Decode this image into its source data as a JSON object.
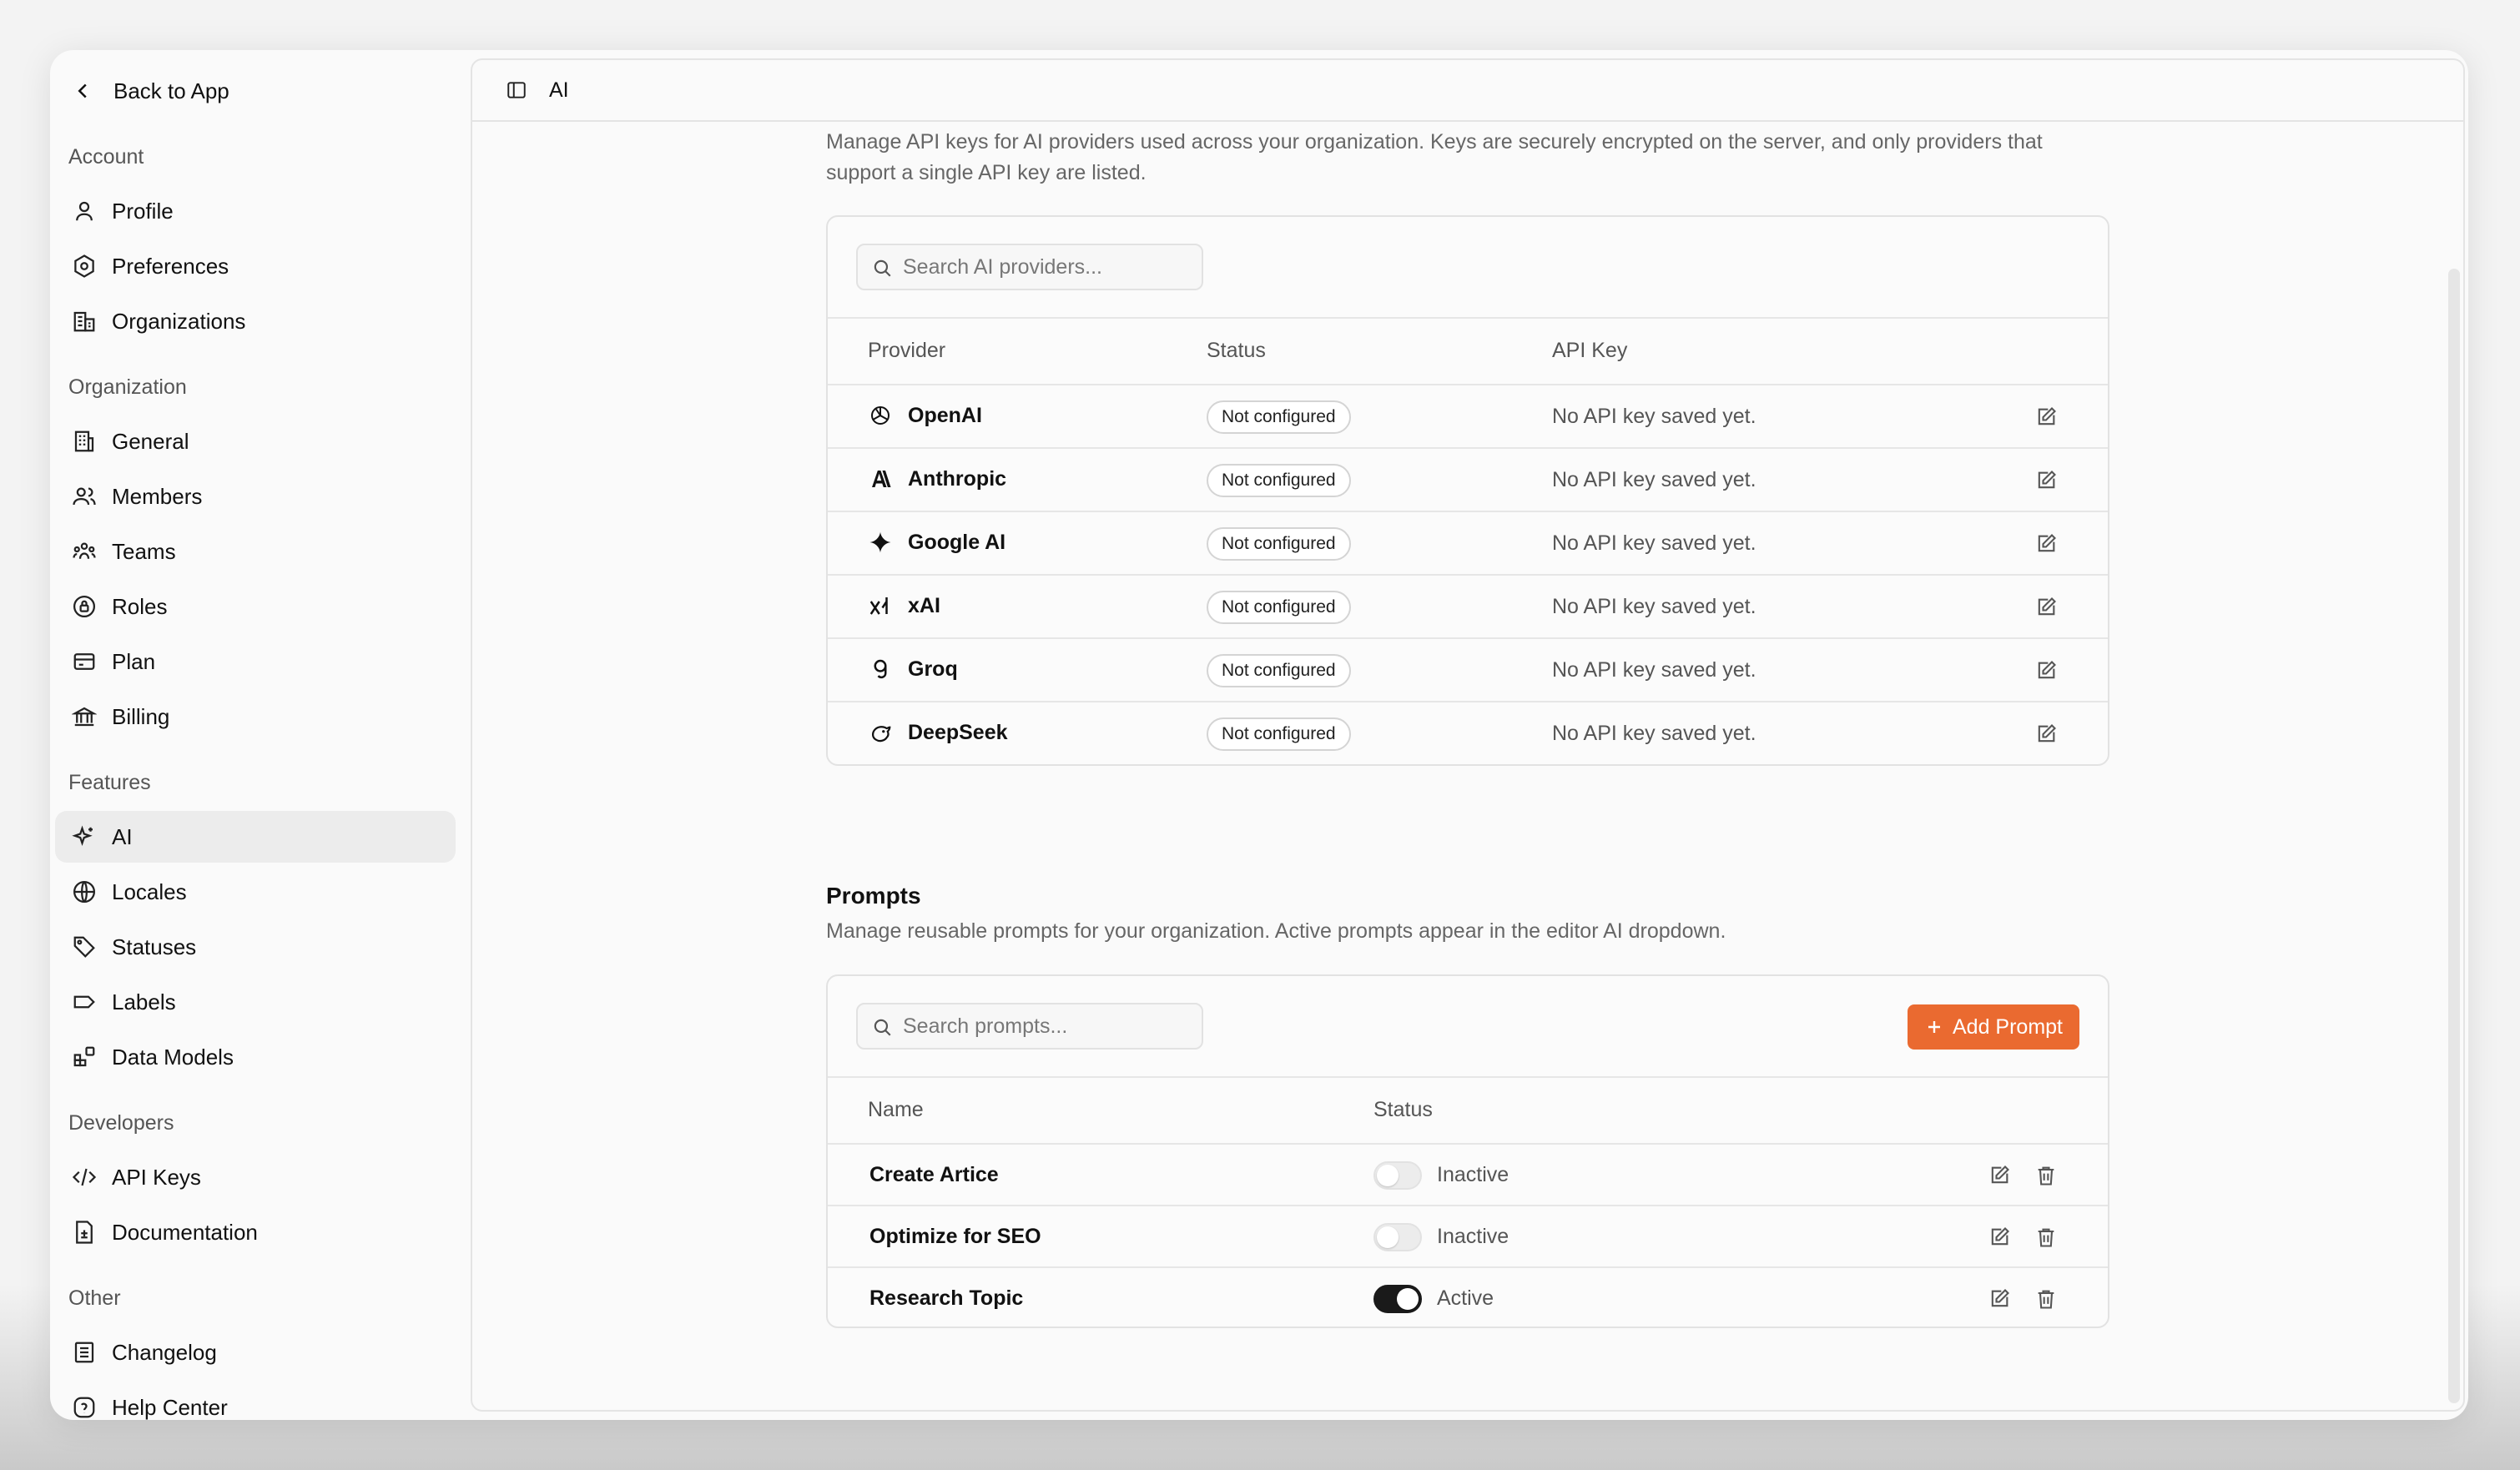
{
  "sidebar": {
    "back_label": "Back to App",
    "sections": {
      "account": "Account",
      "organization": "Organization",
      "features": "Features",
      "developers": "Developers",
      "other": "Other"
    },
    "items": {
      "profile": "Profile",
      "preferences": "Preferences",
      "organizations": "Organizations",
      "general": "General",
      "members": "Members",
      "teams": "Teams",
      "roles": "Roles",
      "plan": "Plan",
      "billing": "Billing",
      "ai": "AI",
      "locales": "Locales",
      "statuses": "Statuses",
      "labels": "Labels",
      "data_models": "Data Models",
      "api_keys": "API Keys",
      "documentation": "Documentation",
      "changelog": "Changelog",
      "help_center": "Help Center"
    },
    "active": "ai"
  },
  "topbar": {
    "title": "AI"
  },
  "providers_section": {
    "description": "Manage API keys for AI providers used across your organization. Keys are securely encrypted on the server, and only providers that support a single API key are listed.",
    "search_placeholder": "Search AI providers...",
    "columns": {
      "provider": "Provider",
      "status": "Status",
      "api_key": "API Key"
    },
    "rows": [
      {
        "name": "OpenAI",
        "status": "Not configured",
        "api_key": "No API key saved yet.",
        "icon": "openai-icon"
      },
      {
        "name": "Anthropic",
        "status": "Not configured",
        "api_key": "No API key saved yet.",
        "icon": "anthropic-icon"
      },
      {
        "name": "Google AI",
        "status": "Not configured",
        "api_key": "No API key saved yet.",
        "icon": "google-ai-icon"
      },
      {
        "name": "xAI",
        "status": "Not configured",
        "api_key": "No API key saved yet.",
        "icon": "xai-icon"
      },
      {
        "name": "Groq",
        "status": "Not configured",
        "api_key": "No API key saved yet.",
        "icon": "groq-icon"
      },
      {
        "name": "DeepSeek",
        "status": "Not configured",
        "api_key": "No API key saved yet.",
        "icon": "deepseek-icon"
      }
    ]
  },
  "prompts_section": {
    "title": "Prompts",
    "description": "Manage reusable prompts for your organization. Active prompts appear in the editor AI dropdown.",
    "search_placeholder": "Search prompts...",
    "add_label": "Add Prompt",
    "accent_color": "#ea6a30",
    "columns": {
      "name": "Name",
      "status": "Status"
    },
    "rows": [
      {
        "name": "Create Artice",
        "status": "Inactive",
        "active": false
      },
      {
        "name": "Optimize for SEO",
        "status": "Inactive",
        "active": false
      },
      {
        "name": "Research Topic",
        "status": "Active",
        "active": true
      }
    ]
  }
}
